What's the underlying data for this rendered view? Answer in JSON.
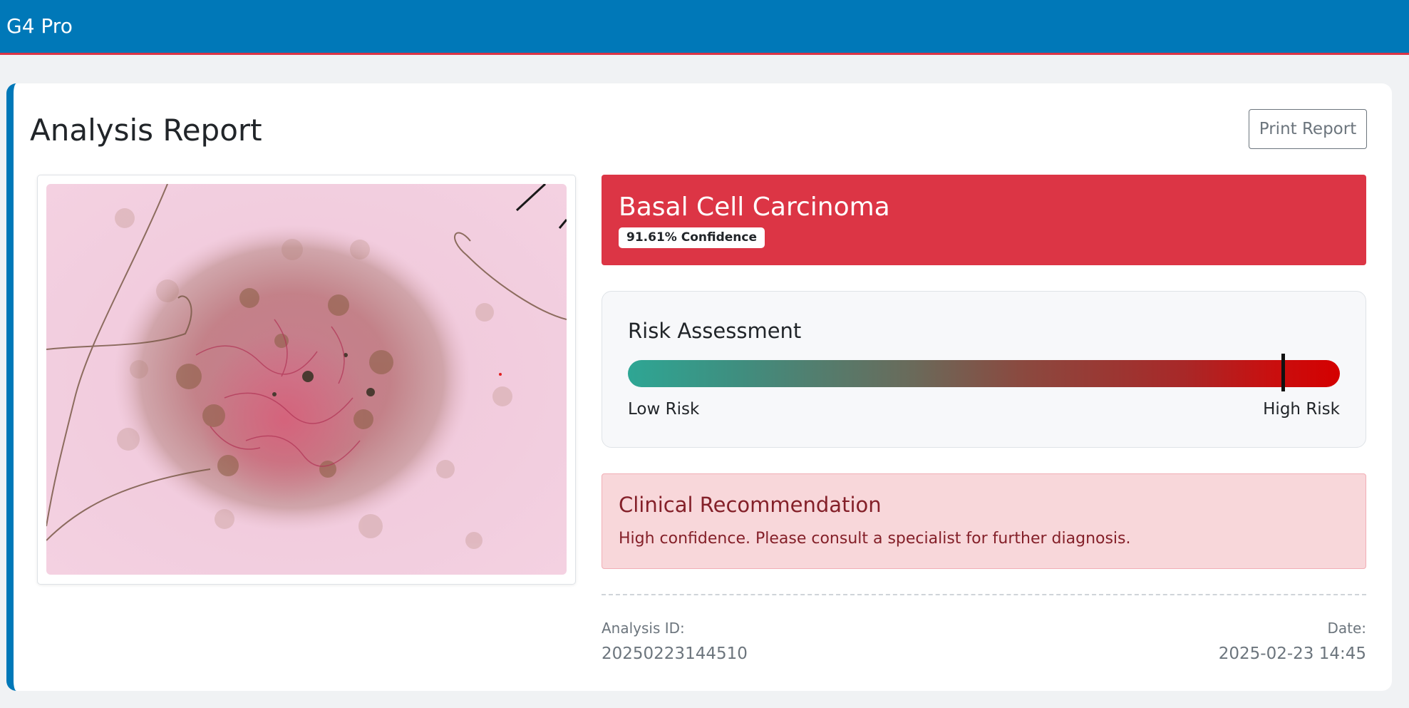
{
  "app": {
    "brand": "G4 Pro"
  },
  "report": {
    "title": "Analysis Report",
    "print_label": "Print Report"
  },
  "diagnosis": {
    "name": "Basal Cell Carcinoma",
    "confidence_label": "91.61% Confidence",
    "confidence_value": 91.61
  },
  "risk": {
    "title": "Risk Assessment",
    "low_label": "Low Risk",
    "high_label": "High Risk",
    "level": 0.92
  },
  "recommendation": {
    "title": "Clinical Recommendation",
    "text": "High confidence. Please consult a specialist for further diagnosis."
  },
  "meta": {
    "id_label": "Analysis ID:",
    "id_value": "20250223144510",
    "date_label": "Date:",
    "date_value": "2025-02-23 14:45"
  },
  "colors": {
    "primary": "#0078b8",
    "danger": "#dc3545",
    "risk_low": "#2ea694",
    "risk_high": "#d40000",
    "rec_bg": "#f8d7da",
    "rec_text": "#842029"
  }
}
